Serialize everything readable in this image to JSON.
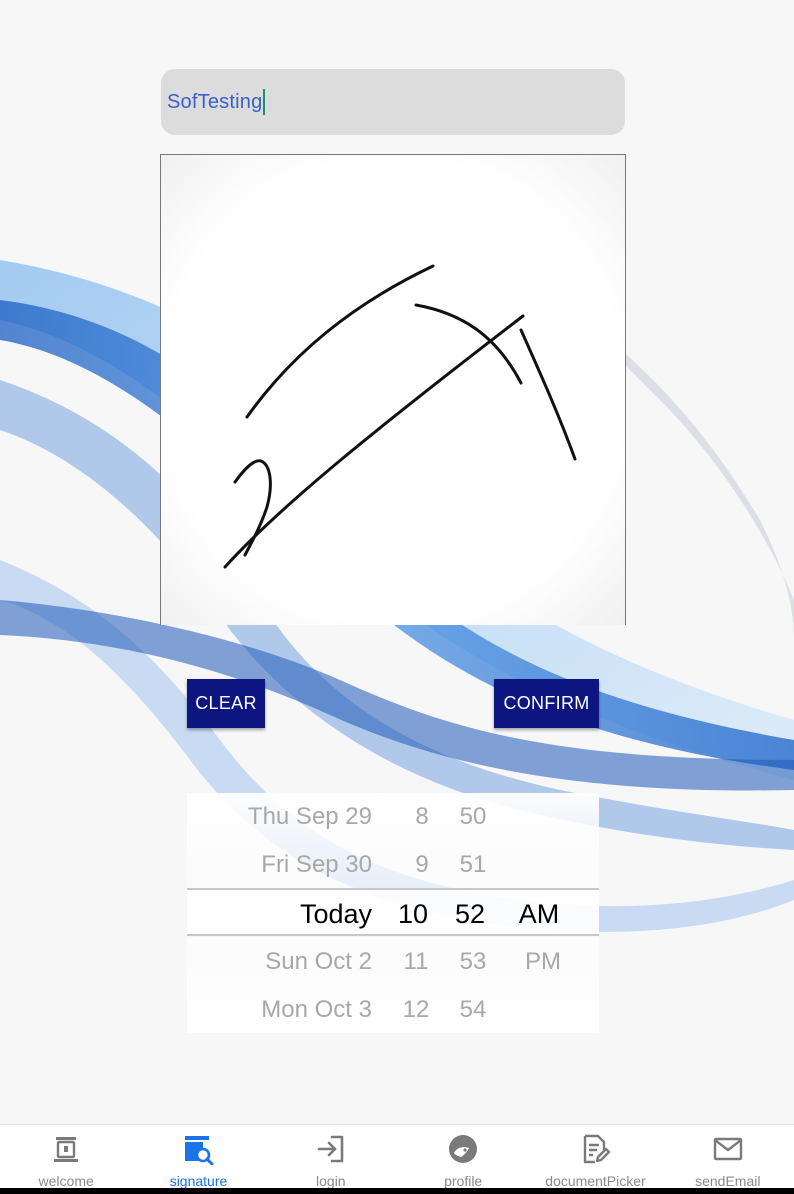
{
  "name_field": {
    "value": "SofTesting"
  },
  "buttons": {
    "clear": "CLEAR",
    "confirm": "CONFIRM"
  },
  "picker": {
    "dates": [
      "Thu Sep 29",
      "Fri Sep 30",
      "Today",
      "Sun Oct 2",
      "Mon Oct 3"
    ],
    "hours": [
      "8",
      "9",
      "10",
      "11",
      "12"
    ],
    "minutes": [
      "50",
      "51",
      "52",
      "53",
      "54"
    ],
    "ampm": [
      "",
      "",
      "AM",
      "PM",
      ""
    ],
    "selected": {
      "date": "Today",
      "hour": "10",
      "minute": "52",
      "ampm": "AM"
    }
  },
  "tabs": [
    {
      "label": "welcome",
      "icon": "welcome-icon",
      "active": false
    },
    {
      "label": "signature",
      "icon": "signature-icon",
      "active": true
    },
    {
      "label": "login",
      "icon": "login-icon",
      "active": false
    },
    {
      "label": "profile",
      "icon": "profile-icon",
      "active": false
    },
    {
      "label": "documentPicker",
      "icon": "document-picker-icon",
      "active": false
    },
    {
      "label": "sendEmail",
      "icon": "send-email-icon",
      "active": false
    }
  ],
  "colors": {
    "button_bg": "#0d1580",
    "active_tab": "#1a73e8",
    "inactive_tab": "#8a8a8a",
    "input_text": "#3a5fcd"
  }
}
